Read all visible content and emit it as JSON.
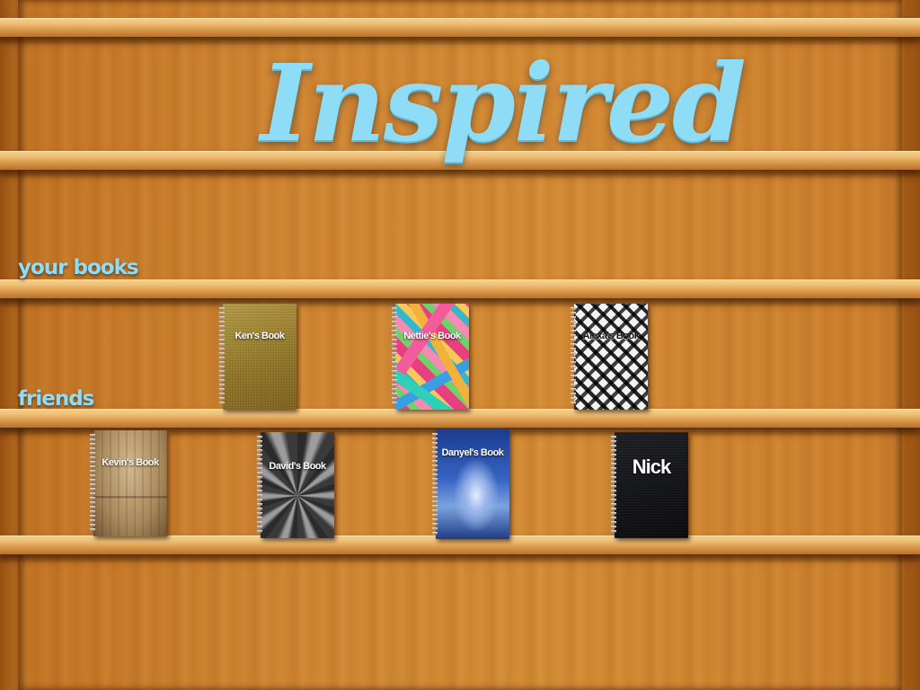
{
  "app": {
    "title": "Inspired"
  },
  "sections": {
    "your_books": "your books",
    "friends": "friends"
  },
  "your_books": [
    {
      "title": "Ken's Book",
      "cover": "gold-linen"
    },
    {
      "title": "Nettie's Book",
      "cover": "colorful-geometric"
    },
    {
      "title": "Alexa's Book",
      "cover": "black-white-plaid"
    }
  ],
  "friends_books": [
    {
      "title": "Kevin's Book",
      "cover": "tan-room"
    },
    {
      "title": "David's Book",
      "cover": "brushed-metal"
    },
    {
      "title": "Danyel's Book",
      "cover": "unicorn-sky"
    },
    {
      "title": "Nick",
      "cover": "black-leather"
    }
  ],
  "colors": {
    "logo": "#8fdcf6",
    "label": "#8fdcf6",
    "wood": "#d38a30",
    "shelf": "#eec078"
  }
}
